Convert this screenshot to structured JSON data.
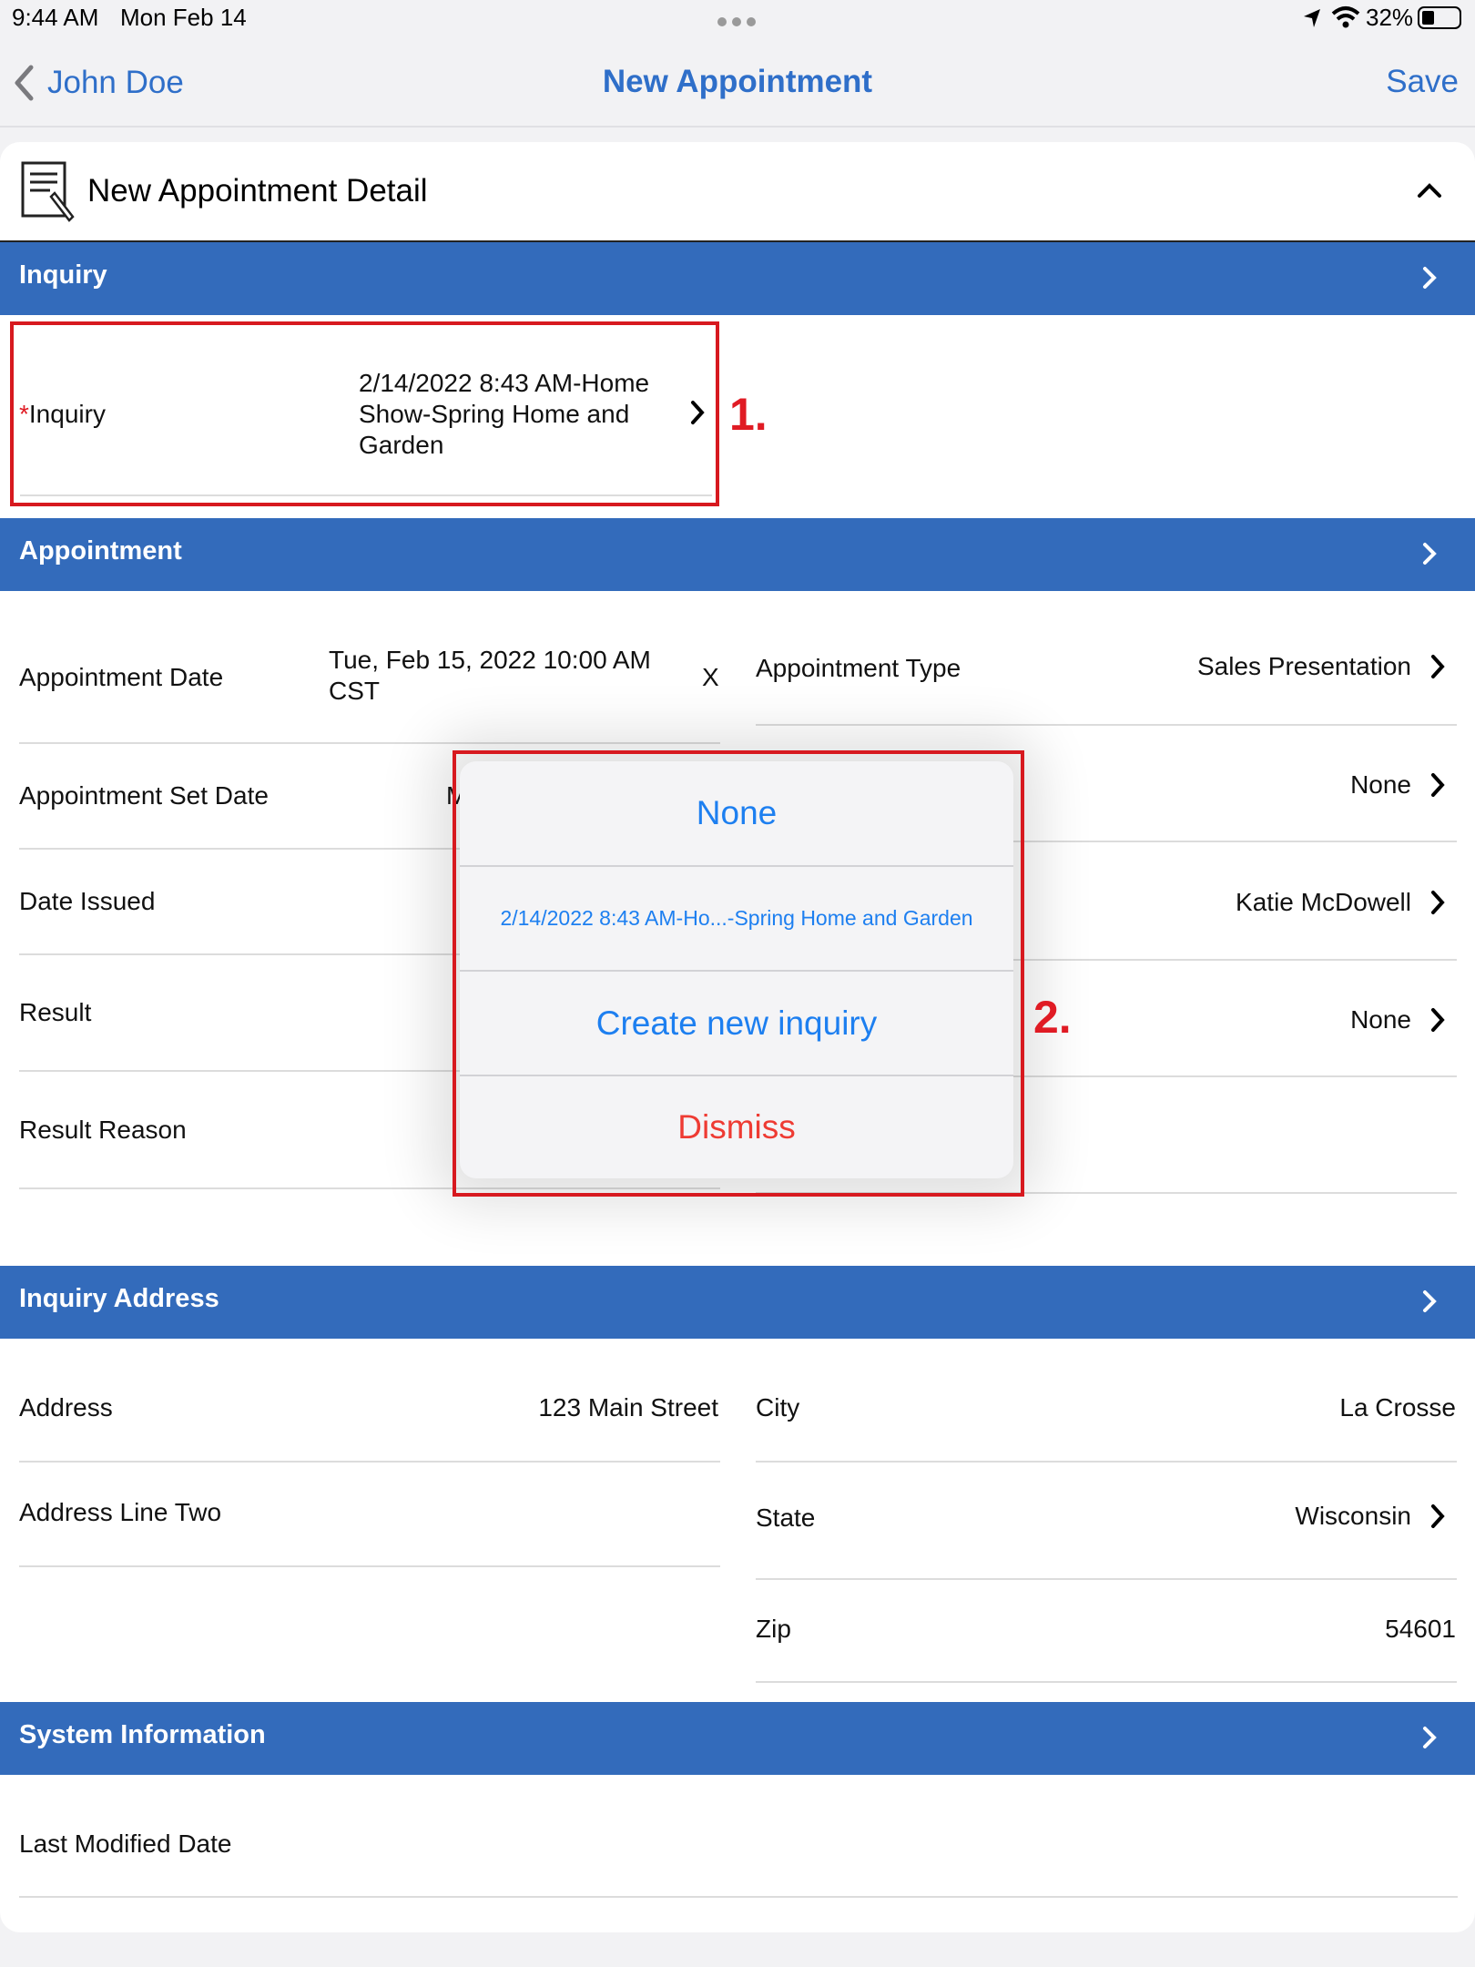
{
  "status": {
    "time": "9:44 AM",
    "date": "Mon Feb 14",
    "battery": "32%"
  },
  "nav": {
    "back_label": "John Doe",
    "title": "New Appointment",
    "save_label": "Save"
  },
  "card": {
    "title": "New Appointment Detail",
    "icon": "document-edit-icon"
  },
  "sections": {
    "inquiry": "Inquiry",
    "appointment": "Appointment",
    "address": "Inquiry Address",
    "system": "System Information"
  },
  "inquiry_field": {
    "required_mark": "*",
    "label": "Inquiry",
    "value_line1": "2/14/2022 8:43 AM-Home",
    "value_line2": "Show-Spring Home and",
    "value_line3": "Garden"
  },
  "appointment": {
    "date_label": "Appointment Date",
    "date_value_line1": "Tue, Feb 15, 2022 10:00 AM",
    "date_value_line2": "CST",
    "clear_label": "X",
    "type_label": "Appointment Type",
    "type_value": "Sales Presentation",
    "set_date_label": "Appointment Set Date",
    "set_date_partial": "M",
    "right_value_2": "None",
    "issued_label": "Date Issued",
    "right_value_3": "Katie McDowell",
    "result_label": "Result",
    "right_value_4": "None",
    "result_reason_label": "Result Reason"
  },
  "address": {
    "address_label": "Address",
    "address_value": "123 Main Street",
    "city_label": "City",
    "city_value": "La Crosse",
    "line2_label": "Address Line Two",
    "state_label": "State",
    "state_value": "Wisconsin",
    "zip_label": "Zip",
    "zip_value": "54601"
  },
  "system": {
    "last_modified_label": "Last Modified Date"
  },
  "action_sheet": {
    "option_none": "None",
    "option_inquiry": "2/14/2022 8:43 AM-Ho...-Spring Home and Garden",
    "option_create": "Create new inquiry",
    "option_dismiss": "Dismiss"
  },
  "annotations": {
    "step1": "1.",
    "step2": "2."
  },
  "colors": {
    "accent": "#2f6fc9",
    "section": "#336bbb",
    "annotation": "#d7191f",
    "dismiss": "#ee3b33",
    "link": "#1d7ff0"
  }
}
